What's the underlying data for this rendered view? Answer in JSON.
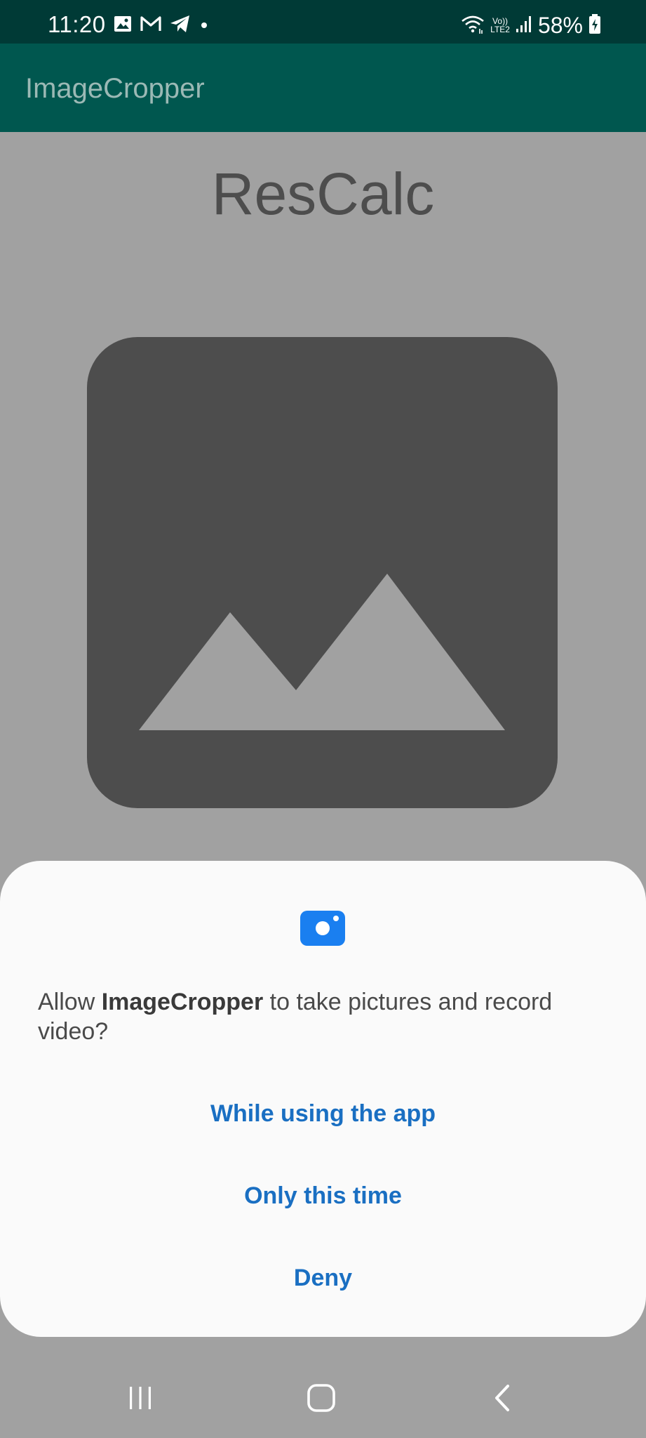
{
  "status_bar": {
    "time": "11:20",
    "network_label_top": "Vo))",
    "network_label_bottom": "LTE2",
    "battery": "58%"
  },
  "app_bar": {
    "title": "ImageCropper"
  },
  "content": {
    "title": "ResCalc"
  },
  "dialog": {
    "message_prefix": "Allow ",
    "app_name": "ImageCropper",
    "message_suffix": " to take pictures and record video?",
    "buttons": {
      "while_using": "While using the app",
      "only_this_time": "Only this time",
      "deny": "Deny"
    }
  },
  "colors": {
    "status_bar": "#003a36",
    "app_bar": "#00574f",
    "dim_background": "#a1a1a1",
    "dialog_background": "#fafafa",
    "button_text": "#1a6fc2",
    "camera_icon": "#1a7ff0"
  },
  "icons": {
    "status_left": [
      "image-icon",
      "gmail-icon",
      "telegram-icon",
      "notification-dot-icon"
    ],
    "status_right": [
      "wifi-icon",
      "volte-lte-icon",
      "signal-icon",
      "battery-icon"
    ],
    "navigation": [
      "recents-icon",
      "home-icon",
      "back-icon"
    ]
  }
}
